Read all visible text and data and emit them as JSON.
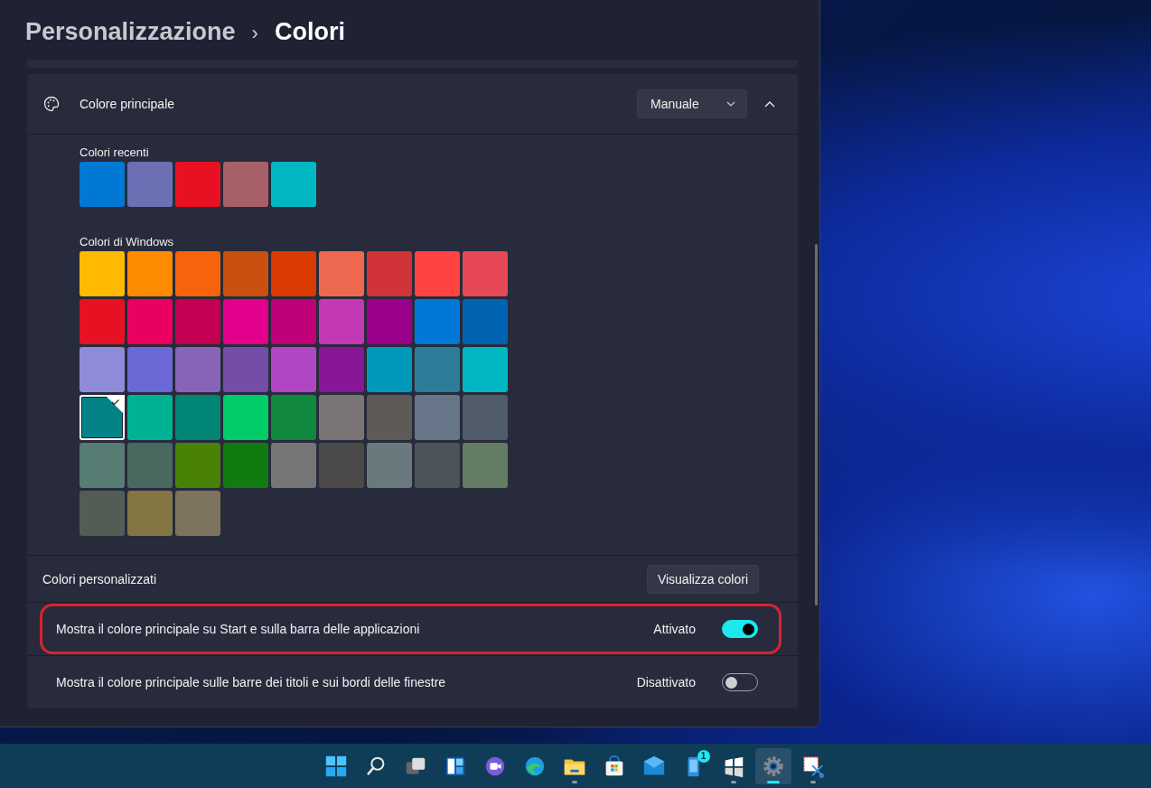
{
  "breadcrumb": {
    "parent": "Personalizzazione",
    "separator": "›",
    "current": "Colori"
  },
  "accent_section": {
    "label": "Colore principale",
    "dropdown": {
      "value": "Manuale"
    },
    "expanded": true,
    "recent": {
      "label": "Colori recenti",
      "colors": [
        {
          "color": "#0078d4"
        },
        {
          "color": "#6b6fb4"
        },
        {
          "color": "#e81123"
        },
        {
          "color": "#a86068"
        },
        {
          "color": "#00b7c3"
        }
      ]
    },
    "windows_colors": {
      "label": "Colori di Windows",
      "colors": [
        {
          "color": "#ffb900",
          "selected": false
        },
        {
          "color": "#ff8c00",
          "selected": false
        },
        {
          "color": "#f7630c",
          "selected": false
        },
        {
          "color": "#ca5010",
          "selected": false
        },
        {
          "color": "#da3b01",
          "selected": false
        },
        {
          "color": "#ef6950",
          "selected": false
        },
        {
          "color": "#d13438",
          "selected": false
        },
        {
          "color": "#ff4343",
          "selected": false
        },
        {
          "color": "#e74856",
          "selected": false
        },
        {
          "color": "#e81123",
          "selected": false
        },
        {
          "color": "#ea005e",
          "selected": false
        },
        {
          "color": "#c30052",
          "selected": false
        },
        {
          "color": "#e3008c",
          "selected": false
        },
        {
          "color": "#bf0077",
          "selected": false
        },
        {
          "color": "#c239b3",
          "selected": false
        },
        {
          "color": "#9a0089",
          "selected": false
        },
        {
          "color": "#0078d7",
          "selected": false
        },
        {
          "color": "#0063b1",
          "selected": false
        },
        {
          "color": "#8e8cd8",
          "selected": false
        },
        {
          "color": "#6b69d6",
          "selected": false
        },
        {
          "color": "#8764b8",
          "selected": false
        },
        {
          "color": "#744da9",
          "selected": false
        },
        {
          "color": "#b146c2",
          "selected": false
        },
        {
          "color": "#881798",
          "selected": false
        },
        {
          "color": "#0099bc",
          "selected": false
        },
        {
          "color": "#2d7d9a",
          "selected": false
        },
        {
          "color": "#00b7c3",
          "selected": false
        },
        {
          "color": "#038387",
          "selected": true
        },
        {
          "color": "#00b294",
          "selected": false
        },
        {
          "color": "#018574",
          "selected": false
        },
        {
          "color": "#00cc6a",
          "selected": false
        },
        {
          "color": "#10893e",
          "selected": false
        },
        {
          "color": "#7a7574",
          "selected": false
        },
        {
          "color": "#5d5a58",
          "selected": false
        },
        {
          "color": "#68768a",
          "selected": false
        },
        {
          "color": "#515c6b",
          "selected": false
        },
        {
          "color": "#567c73",
          "selected": false
        },
        {
          "color": "#486860",
          "selected": false
        },
        {
          "color": "#498205",
          "selected": false
        },
        {
          "color": "#107c10",
          "selected": false
        },
        {
          "color": "#767676",
          "selected": false
        },
        {
          "color": "#4c4a48",
          "selected": false
        },
        {
          "color": "#69797e",
          "selected": false
        },
        {
          "color": "#4a5459",
          "selected": false
        },
        {
          "color": "#647c64",
          "selected": false
        },
        {
          "color": "#525e54",
          "selected": false
        },
        {
          "color": "#847545",
          "selected": false
        },
        {
          "color": "#7e735f",
          "selected": false
        }
      ]
    }
  },
  "custom_colors": {
    "label": "Colori personalizzati",
    "button": "Visualizza colori"
  },
  "toggles": [
    {
      "label": "Mostra il colore principale su Start e sulla barra delle applicazioni",
      "status": "Attivato",
      "on": true,
      "highlighted": true
    },
    {
      "label": "Mostra il colore principale sulle barre dei titoli e sui bordi delle finestre",
      "status": "Disattivato",
      "on": false,
      "highlighted": false
    }
  ],
  "taskbar": [
    {
      "kind": "start",
      "running": false,
      "active": false
    },
    {
      "kind": "search",
      "running": false,
      "active": false
    },
    {
      "kind": "taskview",
      "running": false,
      "active": false
    },
    {
      "kind": "widgets",
      "running": false,
      "active": false
    },
    {
      "kind": "chat",
      "running": false,
      "active": false
    },
    {
      "kind": "browser",
      "running": false,
      "active": false
    },
    {
      "kind": "folder",
      "running": true,
      "active": false
    },
    {
      "kind": "store",
      "running": false,
      "active": false
    },
    {
      "kind": "mail",
      "running": false,
      "active": false
    },
    {
      "kind": "phone",
      "running": false,
      "active": false,
      "badge": "1"
    },
    {
      "kind": "windows",
      "running": true,
      "active": false
    },
    {
      "kind": "settings",
      "running": true,
      "active": true
    },
    {
      "kind": "snip",
      "running": true,
      "active": false
    }
  ]
}
